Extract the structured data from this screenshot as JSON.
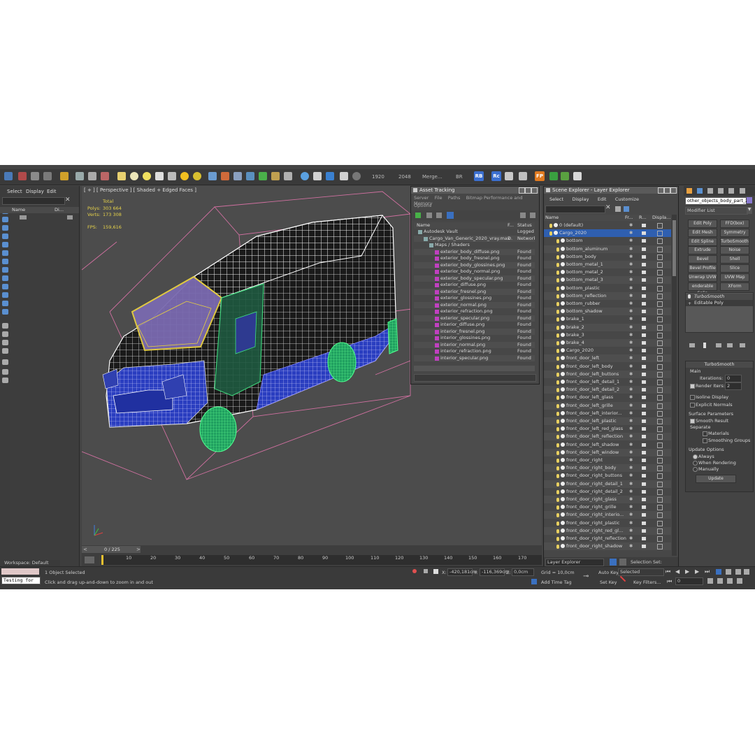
{
  "toolbar": {
    "res_w": "1920",
    "res_h": "2048",
    "merge": "Merge...",
    "br": "BR",
    "badge_rb": "RB",
    "badge_rc": "Rc",
    "badge_fp": "FP"
  },
  "scene_panel": {
    "menu": [
      "Select",
      "Display",
      "Edit"
    ],
    "col_name": "Name",
    "col_di": "Di..."
  },
  "viewport": {
    "label": "[ + ] [ Perspective ] [ Shaded + Edged Faces ]",
    "stats_total": "Total",
    "polys_label": "Polys:",
    "polys_value": "303 664",
    "verts_label": "Verts:",
    "verts_value": "173 308",
    "fps_label": "FPS:",
    "fps_value": "159,616"
  },
  "timeline": {
    "frame": "0 / 225",
    "ticks": [
      "10",
      "20",
      "30",
      "40",
      "50",
      "60",
      "70",
      "80",
      "90",
      "100",
      "110",
      "120",
      "130",
      "140",
      "150",
      "160",
      "170"
    ]
  },
  "asset_tracking": {
    "title": "Asset Tracking",
    "menu": [
      "Server",
      "File",
      "Paths",
      "Bitmap Performance and Memory"
    ],
    "options": "Options",
    "col_name": "Name",
    "col_f": "F...",
    "col_status": "Status",
    "rows": [
      {
        "name": "Autodesk Vault",
        "f": "",
        "status": "Logged Ou"
      },
      {
        "name": "Cargo_Van_Generic_2020_vray.max",
        "f": "D.",
        "status": "Network P"
      },
      {
        "name": "Maps / Shaders",
        "f": "",
        "status": ""
      },
      {
        "name": "exterior_body_diffuse.png",
        "f": "",
        "status": "Found"
      },
      {
        "name": "exterior_body_fresnel.png",
        "f": "",
        "status": "Found"
      },
      {
        "name": "exterior_body_glossines.png",
        "f": "",
        "status": "Found"
      },
      {
        "name": "exterior_body_normal.png",
        "f": "",
        "status": "Found"
      },
      {
        "name": "exterior_body_specular.png",
        "f": "",
        "status": "Found"
      },
      {
        "name": "exterior_diffuse.png",
        "f": "",
        "status": "Found"
      },
      {
        "name": "exterior_fresnel.png",
        "f": "",
        "status": "Found"
      },
      {
        "name": "exterior_glossines.png",
        "f": "",
        "status": "Found"
      },
      {
        "name": "exterior_normal.png",
        "f": "",
        "status": "Found"
      },
      {
        "name": "exterior_refraction.png",
        "f": "",
        "status": "Found"
      },
      {
        "name": "exterior_specular.png",
        "f": "",
        "status": "Found"
      },
      {
        "name": "interior_diffuse.png",
        "f": "",
        "status": "Found"
      },
      {
        "name": "interior_fresnel.png",
        "f": "",
        "status": "Found"
      },
      {
        "name": "interior_glossines.png",
        "f": "",
        "status": "Found"
      },
      {
        "name": "interior_normal.png",
        "f": "",
        "status": "Found"
      },
      {
        "name": "interior_refraction.png",
        "f": "",
        "status": "Found"
      },
      {
        "name": "interior_specular.png",
        "f": "",
        "status": "Found"
      }
    ]
  },
  "scene_explorer": {
    "title": "Scene Explorer - Layer Explorer",
    "menu": [
      "Select",
      "Display",
      "Edit",
      "Customize"
    ],
    "col_name": "Name",
    "col_fr": "Fr...",
    "col_r": "R...",
    "col_disp": "Displa...",
    "items": [
      "0 (default)",
      "Cargo_2020",
      "bottom",
      "bottom_aluminum",
      "bottom_body",
      "bottom_metal_1",
      "bottom_metal_2",
      "bottom_metal_3",
      "bottom_plastic",
      "bottom_reflection",
      "bottom_rubber",
      "bottom_shadow",
      "brake_1",
      "brake_2",
      "brake_3",
      "brake_4",
      "Cargo_2020",
      "front_door_left",
      "front_door_left_body",
      "front_door_left_buttons",
      "front_door_left_detail_1",
      "front_door_left_detail_2",
      "front_door_left_glass",
      "front_door_left_grille",
      "front_door_left_interior...",
      "front_door_left_plastic",
      "front_door_left_red_glass",
      "front_door_left_reflection",
      "front_door_left_shadow",
      "front_door_left_window",
      "front_door_right",
      "front_door_right_body",
      "front_door_right_buttons",
      "front_door_right_detail_1",
      "front_door_right_detail_2",
      "front_door_right_glass",
      "front_door_right_grille",
      "front_door_right_interio...",
      "front_door_right_plastic",
      "front_door_right_red_gl...",
      "front_door_right_reflection",
      "front_door_right_shadow"
    ],
    "footer_label": "Layer Explorer",
    "selection_set": "Selection Set:"
  },
  "command_panel": {
    "object_name": "other_objects_body_part_2",
    "modifier_list": "Modifier List",
    "buttons": [
      "Edit Poly",
      "FFD(box)",
      "Edit Mesh",
      "Symmetry",
      "Edit Spline",
      "TurboSmooth",
      "Extrude",
      "Noise",
      "Bevel",
      "Shell",
      "Bevel Profile",
      "Slice",
      "Unwrap UVW",
      "UVW Map",
      "enderable Splin",
      "XForm"
    ],
    "stack": [
      "TurboSmooth",
      "Editable Poly"
    ],
    "rollout_title": "TurboSmooth",
    "main": "Main",
    "iterations_label": "Iterations:",
    "iterations_value": "0",
    "render_iters_label": "Render Iters:",
    "render_iters_value": "2",
    "isoline": "Isoline Display",
    "explicit_normals": "Explicit Normals",
    "surface_params": "Surface Parameters",
    "smooth_result": "Smooth Result",
    "separate": "Separate",
    "materials": "Materials",
    "smoothing_groups": "Smoothing Groups",
    "update_options": "Update Options",
    "always": "Always",
    "when_rendering": "When Rendering",
    "manually": "Manually",
    "update": "Update"
  },
  "status": {
    "workspace": "Workspace: Default",
    "script_text": "Testing for",
    "selected": "1 Object Selected",
    "hint": "Click and drag up-and-down to zoom in and out",
    "x_label": "X:",
    "x_value": "-420,181cm",
    "y_label": "Y:",
    "y_value": "-116,369cm",
    "z_label": "Z:",
    "z_value": "0,0cm",
    "grid": "Grid = 10,0cm",
    "add_time_tag": "Add Time Tag",
    "auto_key": "Auto Key",
    "set_key": "Set Key",
    "selected_dd": "Selected",
    "key_filters": "Key Filters...",
    "frame_value": "0"
  }
}
